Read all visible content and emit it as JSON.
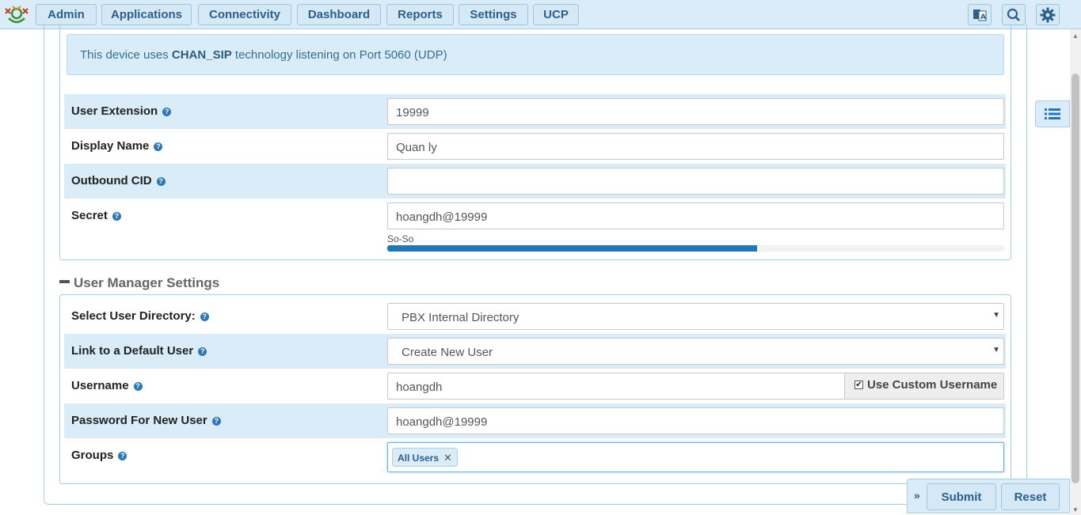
{
  "nav": {
    "items": [
      {
        "label": "Admin"
      },
      {
        "label": "Applications"
      },
      {
        "label": "Connectivity"
      },
      {
        "label": "Dashboard"
      },
      {
        "label": "Reports"
      },
      {
        "label": "Settings"
      },
      {
        "label": "UCP"
      }
    ],
    "icons": [
      "language-icon",
      "search-icon",
      "gear-icon"
    ]
  },
  "device": {
    "notice_prefix": "This device uses ",
    "technology": "CHAN_SIP",
    "notice_suffix": " technology listening on Port 5060 (UDP)",
    "fields": {
      "user_extension": {
        "label": "User Extension",
        "value": "19999"
      },
      "display_name": {
        "label": "Display Name",
        "value": "Quan ly"
      },
      "outbound_cid": {
        "label": "Outbound CID",
        "value": ""
      },
      "secret": {
        "label": "Secret",
        "value": "hoangdh@19999"
      }
    },
    "strength": {
      "label": "So-So",
      "fraction": 0.6
    }
  },
  "user_manager": {
    "title": "User Manager Settings",
    "select_directory": {
      "label": "Select User Directory:",
      "value": "PBX Internal Directory"
    },
    "link_default_user": {
      "label": "Link to a Default User",
      "value": "Create New User"
    },
    "username": {
      "label": "Username",
      "value": "hoangdh",
      "custom_label": "Use Custom Username",
      "custom_checked": true
    },
    "password": {
      "label": "Password For New User",
      "value": "hoangdh@19999"
    },
    "groups": {
      "label": "Groups",
      "tags": [
        "All Users"
      ]
    }
  },
  "actions": {
    "submit": "Submit",
    "reset": "Reset"
  },
  "colors": {
    "accent": "#2377b6",
    "panel": "#d9ecf7",
    "border": "#a9cfe6"
  }
}
